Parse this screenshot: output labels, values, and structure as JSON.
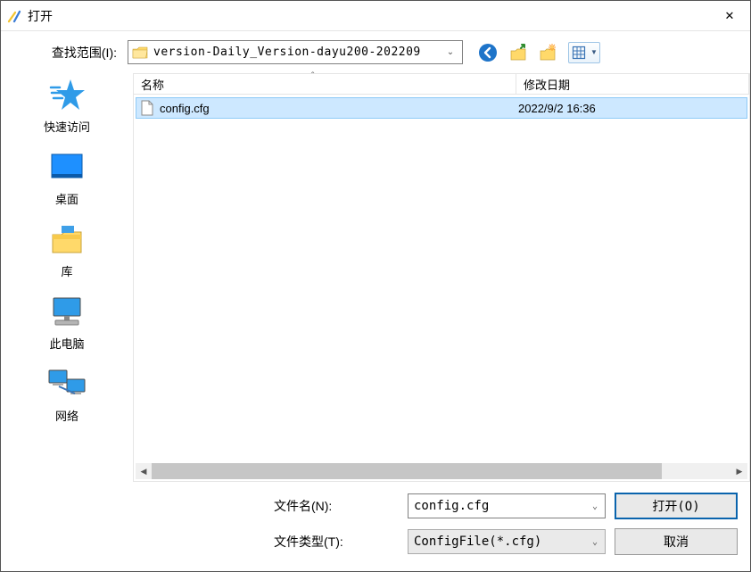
{
  "title": "打开",
  "look_in_label": "查找范围(I):",
  "path_text": "version-Daily_Version-dayu200-202209",
  "columns": {
    "name": "名称",
    "date": "修改日期"
  },
  "file": {
    "name": "config.cfg",
    "date": "2022/9/2 16:36"
  },
  "filename_label": "文件名(N):",
  "filetype_label": "文件类型(T):",
  "filename_value": "config.cfg",
  "filetype_value": "ConfigFile(*.cfg)",
  "open_btn": "打开(O)",
  "cancel_btn": "取消",
  "sidebar": {
    "quick": "快速访问",
    "desktop": "桌面",
    "libs": "库",
    "pc": "此电脑",
    "net": "网络"
  },
  "icons": {
    "close_glyph": "✕",
    "chev_down": "⌄",
    "sort_up": "ˆ",
    "left": "◀",
    "right": "▶"
  }
}
